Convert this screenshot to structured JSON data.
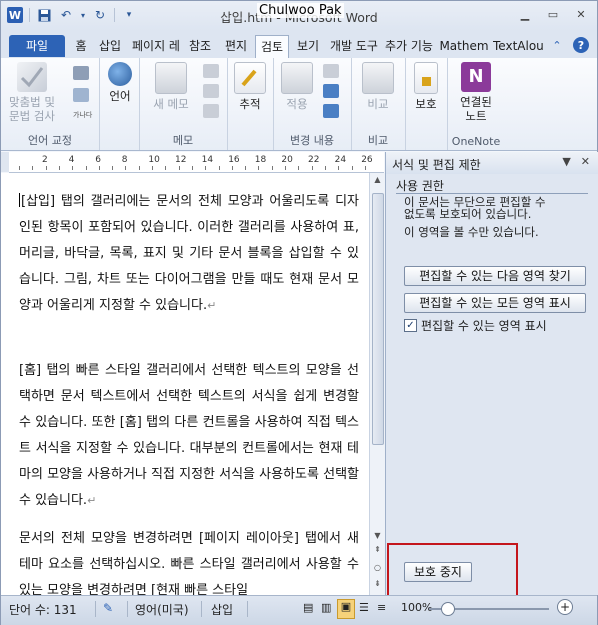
{
  "window": {
    "title": "삽입.htm - Microsoft Word",
    "overlay_user": "Chulwoo Pak",
    "app_letter": "W"
  },
  "tabs": [
    "파일",
    "홈",
    "삽입",
    "페이지 레",
    "참조",
    "편지",
    "검토",
    "보기",
    "개발 도구",
    "추가 기능",
    "Mathem",
    "TextAlou"
  ],
  "active_tab": "검토",
  "ribbon": {
    "groups": [
      {
        "label": "언어 교정",
        "buttons": [
          "맞춤법 및\n문법 검사"
        ],
        "small_glyph": "가나다"
      },
      {
        "label": "",
        "buttons": [
          "언어"
        ]
      },
      {
        "label": "메모",
        "buttons": [
          "새 메모"
        ]
      },
      {
        "label": "",
        "buttons": [
          "추적"
        ]
      },
      {
        "label": "변경 내용",
        "buttons": [
          "적용"
        ]
      },
      {
        "label": "비교",
        "buttons": [
          "비교"
        ]
      },
      {
        "label": "",
        "buttons": [
          "보호"
        ]
      },
      {
        "label": "OneNote",
        "buttons": [
          "연결된\n노트"
        ]
      }
    ]
  },
  "ruler": {
    "marks": [
      "2",
      "4",
      "6",
      "8",
      "10",
      "12",
      "14",
      "16",
      "18",
      "20",
      "22",
      "24",
      "26"
    ]
  },
  "document": {
    "paragraphs": [
      "[삽입] 탭의 갤러리에는 문서의 전체 모양과 어울리도록 디자인된 항목이 포함되어 있습니다. 이러한 갤러리를 사용하여 표, 머리글, 바닥글, 목록, 표지 및 기타 문서 블록을 삽입할 수 있습니다. 그림, 차트 또는 다이어그램을 만들 때도 현재 문서 모양과 어울리게 지정할 수 있습니다.",
      "[홈] 탭의 빠른 스타일 갤러리에서 선택한 텍스트의 모양을 선택하면 문서 텍스트에서 선택한 텍스트의 서식을 쉽게 변경할 수 있습니다. 또한 [홈] 탭의 다른 컨트롤을 사용하여 직접 텍스트 서식을 지정할 수 있습니다. 대부분의 컨트롤에서는 현재 테마의 모양을 사용하거나 직접 지정한 서식을 사용하도록 선택할 수 있습니다.",
      "문서의 전체 모양을 변경하려면 [페이지 레이아웃] 탭에서 새 테마 요소를 선택하십시오. 빠른 스타일 갤러리에서 사용할 수 있는 모양을 변경하려면 [현재 빠른 스타일"
    ],
    "paragraph_mark": "↵"
  },
  "pane": {
    "title": "서식 및 편집 제한",
    "section": "사용 권한",
    "message_lines": [
      "이 문서는 무단으로 편집할 수",
      "없도록 보호되어 있습니다.",
      "이 영역을 볼 수만 있습니다."
    ],
    "btn_find_next": "편집할 수 있는 다음 영역 찾기",
    "btn_show_all": "편집할 수 있는 모든 영역 표시",
    "checkbox_label": "편집할 수 있는 영역 표시",
    "checkbox_checked": true,
    "btn_stop": "보호 중지"
  },
  "status": {
    "words": "단어 수: 131",
    "language": "영어(미국)",
    "mode": "삽입",
    "zoom": "100%"
  }
}
